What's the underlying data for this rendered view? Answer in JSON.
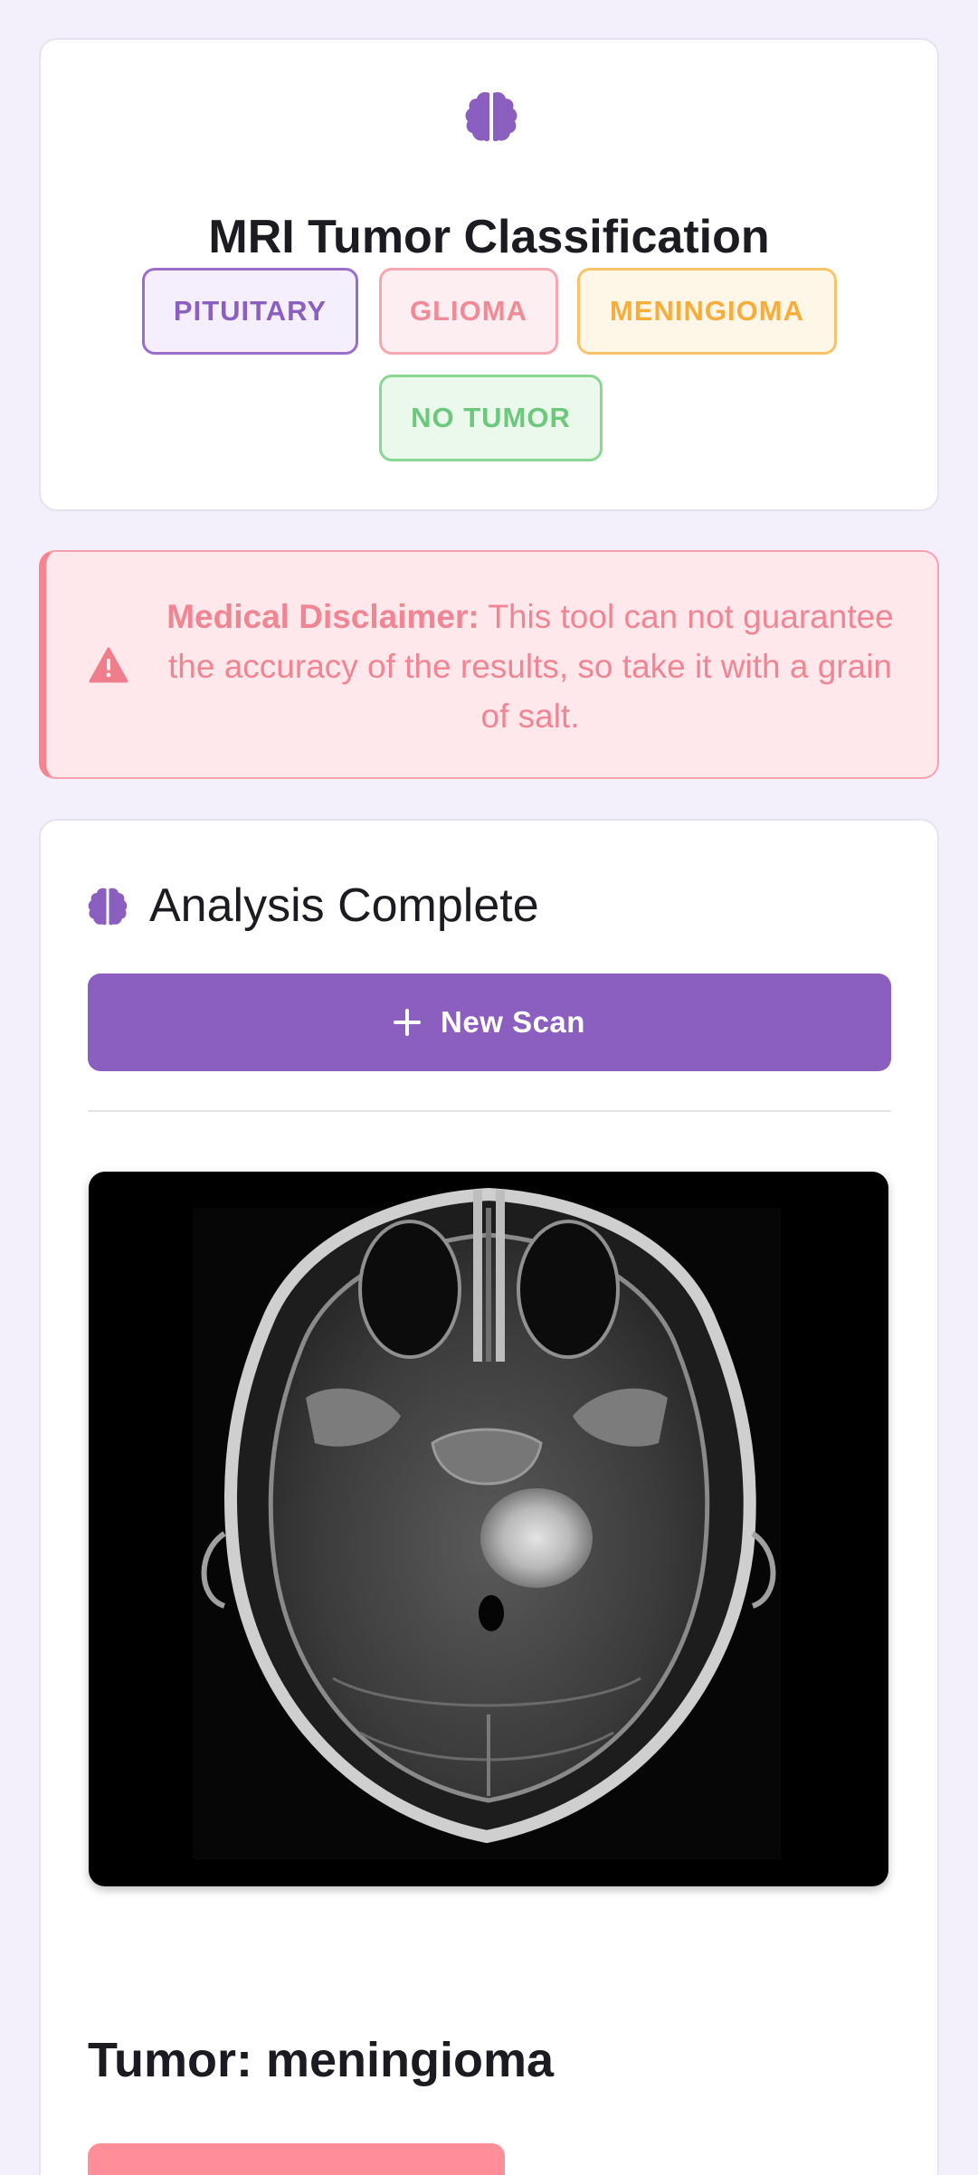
{
  "header": {
    "title": "MRI Tumor Classification",
    "icon": "brain-icon",
    "accent_color": "#8a5fbf",
    "categories": [
      {
        "label": "PITUITARY",
        "color": "#8a5fbf"
      },
      {
        "label": "GLIOMA",
        "color": "#f18a97"
      },
      {
        "label": "MENINGIOMA",
        "color": "#f6ad3b"
      },
      {
        "label": "NO TUMOR",
        "color": "#6cc87c"
      }
    ]
  },
  "disclaimer": {
    "icon": "warning-icon",
    "heading": "Medical Disclaimer:",
    "text": "This tool can not guarantee the accuracy of the results, so take it with a grain of salt."
  },
  "results": {
    "icon": "brain-icon",
    "title": "Analysis Complete",
    "new_scan_label": "New Scan",
    "new_scan_icon": "plus-icon",
    "result_text": "Tumor: meningioma",
    "result_color": "#ff8e98"
  }
}
